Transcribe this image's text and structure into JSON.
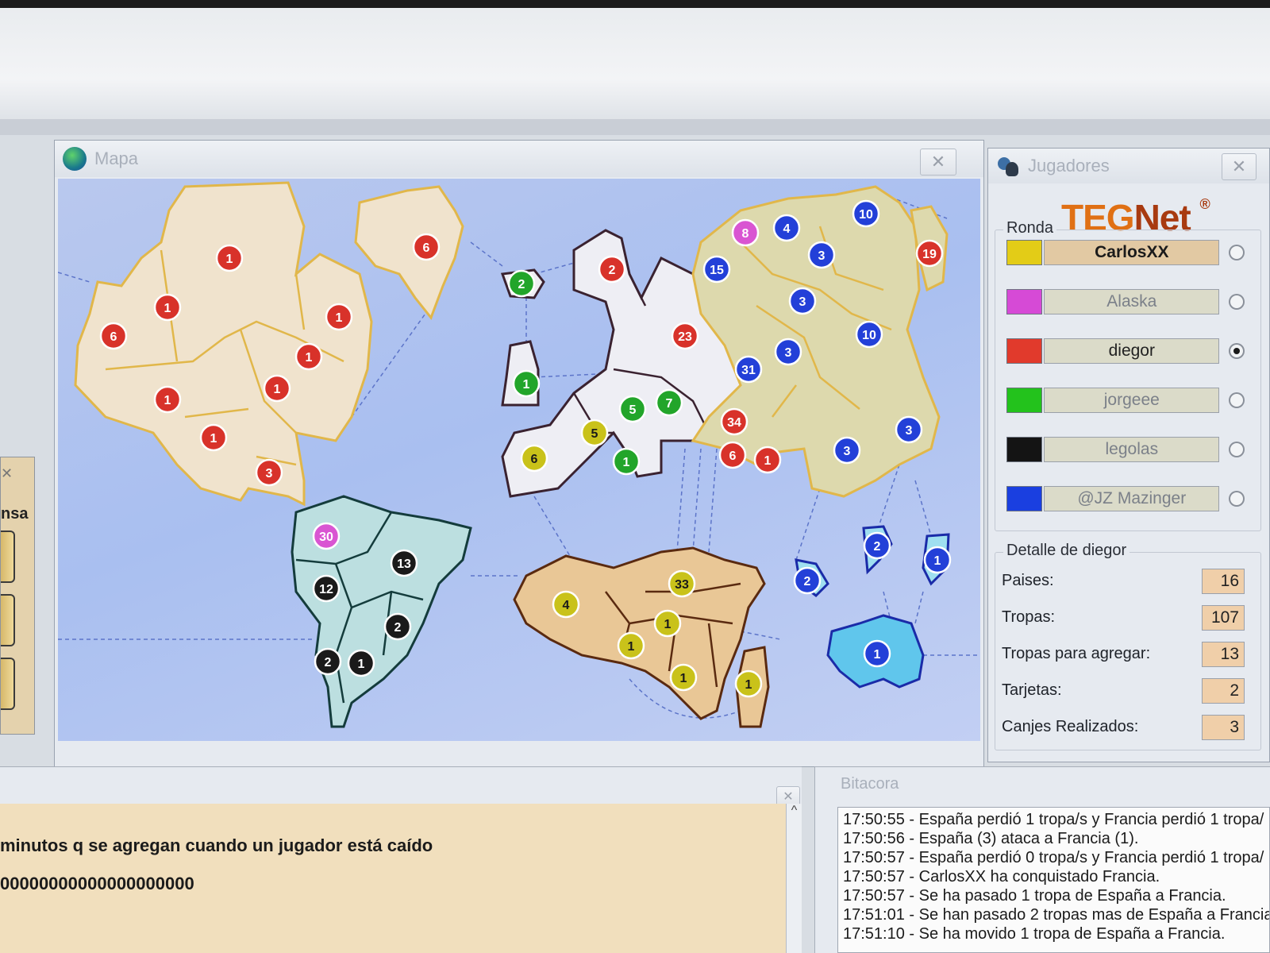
{
  "map_window": {
    "title": "Mapa",
    "close_label": "✕"
  },
  "players_window": {
    "title": "Jugadores",
    "close_label": "✕",
    "logo_teg": "TEG",
    "logo_net": "Net",
    "logo_mark": "®",
    "round_label": "Ronda",
    "players": [
      {
        "name": "CarlosXX",
        "color": "#e3cc17"
      },
      {
        "name": "Alaska",
        "color": "#d64ad6"
      },
      {
        "name": "diegor",
        "color": "#e13a2c"
      },
      {
        "name": "jorgeee",
        "color": "#23c21c"
      },
      {
        "name": "legolas",
        "color": "#141414"
      },
      {
        "name": "@JZ Mazinger",
        "color": "#1a3fe0"
      }
    ],
    "detail_title": "Detalle de diegor",
    "details": [
      {
        "label": "Paises:",
        "value": "16"
      },
      {
        "label": "Tropas:",
        "value": "107"
      },
      {
        "label": "Tropas para agregar:",
        "value": "13"
      },
      {
        "label": "Tarjetas:",
        "value": "2"
      },
      {
        "label": "Canjes Realizados:",
        "value": "3"
      }
    ]
  },
  "left_panel": {
    "label": "nsa",
    "close_label": "✕"
  },
  "chat": {
    "close_label": "✕",
    "scroll_up": "^",
    "lines": [
      "minutos q se agregan cuando un jugador está caído",
      "00000000000000000000"
    ]
  },
  "log": {
    "title": "Bitacora",
    "lines": [
      "17:50:55 - España perdió 1 tropa/s y Francia perdió 1 tropa/",
      "17:50:56 - España (3) ataca a Francia (1).",
      "17:50:57 - España perdió 0 tropa/s y Francia perdió 1 tropa/",
      "17:50:57 - CarlosXX ha conquistado Francia.",
      "17:50:57 - Se ha pasado 1 tropa de España a Francia.",
      "17:51:01 - Se han pasado 2 tropas mas de España a Francia",
      "17:51:10 - Se ha movido 1 tropa de España a Francia."
    ]
  },
  "map_markers": [
    {
      "value": "1",
      "owner": "red"
    },
    {
      "value": "1",
      "owner": "red"
    },
    {
      "value": "6",
      "owner": "red"
    },
    {
      "value": "1",
      "owner": "red"
    },
    {
      "value": "1",
      "owner": "red"
    },
    {
      "value": "1",
      "owner": "red"
    },
    {
      "value": "1",
      "owner": "red"
    },
    {
      "value": "1",
      "owner": "red"
    },
    {
      "value": "3",
      "owner": "red"
    },
    {
      "value": "6",
      "owner": "red"
    },
    {
      "value": "2",
      "owner": "green"
    },
    {
      "value": "1",
      "owner": "green"
    },
    {
      "value": "2",
      "owner": "red"
    },
    {
      "value": "23",
      "owner": "red"
    },
    {
      "value": "5",
      "owner": "green"
    },
    {
      "value": "7",
      "owner": "green"
    },
    {
      "value": "1",
      "owner": "green"
    },
    {
      "value": "5",
      "owner": "yellow"
    },
    {
      "value": "6",
      "owner": "yellow"
    },
    {
      "value": "8",
      "owner": "magenta"
    },
    {
      "value": "4",
      "owner": "blue"
    },
    {
      "value": "10",
      "owner": "blue"
    },
    {
      "value": "15",
      "owner": "blue"
    },
    {
      "value": "3",
      "owner": "blue"
    },
    {
      "value": "3",
      "owner": "blue"
    },
    {
      "value": "10",
      "owner": "blue"
    },
    {
      "value": "3",
      "owner": "blue"
    },
    {
      "value": "31",
      "owner": "blue"
    },
    {
      "value": "19",
      "owner": "red"
    },
    {
      "value": "34",
      "owner": "red"
    },
    {
      "value": "6",
      "owner": "red"
    },
    {
      "value": "1",
      "owner": "red"
    },
    {
      "value": "3",
      "owner": "blue"
    },
    {
      "value": "3",
      "owner": "blue"
    },
    {
      "value": "30",
      "owner": "magenta"
    },
    {
      "value": "13",
      "owner": "black"
    },
    {
      "value": "12",
      "owner": "black"
    },
    {
      "value": "2",
      "owner": "black"
    },
    {
      "value": "2",
      "owner": "black"
    },
    {
      "value": "1",
      "owner": "black"
    },
    {
      "value": "4",
      "owner": "yellow"
    },
    {
      "value": "33",
      "owner": "yellow"
    },
    {
      "value": "1",
      "owner": "yellow"
    },
    {
      "value": "1",
      "owner": "yellow"
    },
    {
      "value": "1",
      "owner": "yellow"
    },
    {
      "value": "1",
      "owner": "yellow"
    },
    {
      "value": "2",
      "owner": "blue"
    },
    {
      "value": "2",
      "owner": "blue"
    },
    {
      "value": "1",
      "owner": "blue"
    },
    {
      "value": "1",
      "owner": "blue"
    }
  ],
  "owner_colors": {
    "red": "#d8322a",
    "green": "#22a52a",
    "yellow": "#c9c21a",
    "magenta": "#d955d2",
    "blue": "#2340d8",
    "black": "#1a1a1a"
  }
}
